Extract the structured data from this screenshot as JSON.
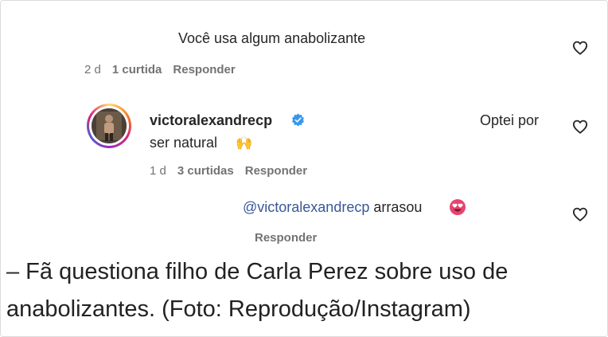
{
  "comments": [
    {
      "text": "Você usa algum anabolizante",
      "age": "2 d",
      "likes": "1 curtida",
      "reply_label": "Responder",
      "like_icon": "heart-outline"
    },
    {
      "username": "victoralexandrecp",
      "verified_icon": "verified-badge",
      "text_part1": "Optei por",
      "text_part2": "ser natural",
      "emoji": "🙌",
      "age": "1 d",
      "likes": "3 curtidas",
      "reply_label": "Responder",
      "like_icon": "heart-outline"
    },
    {
      "mention": "@victoralexandrecp",
      "text": "arrasou",
      "emoji": "😍",
      "reply_label": "Responder",
      "like_icon": "heart-outline"
    }
  ],
  "caption": "– Fã questiona filho de Carla Perez sobre uso de anabolizantes. (Foto: Reprodução/Instagram)",
  "colors": {
    "text": "#262626",
    "meta": "#737373",
    "mention": "#385898",
    "verified": "#3797f0"
  }
}
